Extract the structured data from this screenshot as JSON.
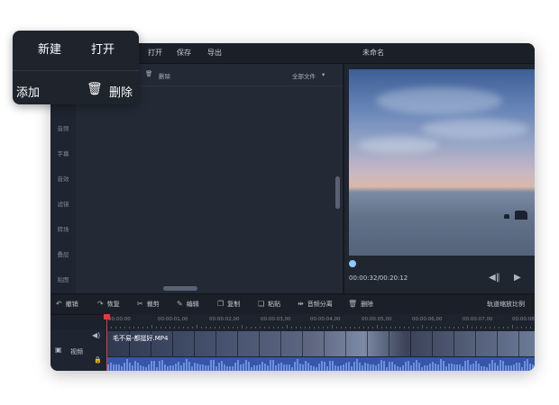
{
  "menu": {
    "open": "打开",
    "save": "保存",
    "export": "导出",
    "window_title": "未命名"
  },
  "popup": {
    "new": "新建",
    "open": "打开",
    "add": "添加",
    "delete": "删除"
  },
  "categories": [
    "音频",
    "字幕",
    "音效",
    "滤镜",
    "转场",
    "叠层",
    "贴图"
  ],
  "media_toolbar": {
    "delete": "删除",
    "filter": "全部文件",
    "filter_arrow": "▾"
  },
  "preview": {
    "timecode": "00:00:32/00:20:12",
    "progress_fraction": 0.0
  },
  "tools": [
    {
      "icon": "↶",
      "label": "撤销"
    },
    {
      "icon": "↷",
      "label": "恢复"
    },
    {
      "icon": "✂",
      "label": "裁剪"
    },
    {
      "icon": "✎",
      "label": "编辑"
    },
    {
      "icon": "❐",
      "label": "复制"
    },
    {
      "icon": "❏",
      "label": "粘贴"
    },
    {
      "icon": "⇹",
      "label": "音频分离"
    },
    {
      "icon": "🗑",
      "label": "删除"
    }
  ],
  "track_zoom": "轨道缩放比例",
  "ruler_labels": [
    "00:00:00",
    "00:00:01,00",
    "00:00:02,00",
    "00:00:03,00",
    "00:00:04,00",
    "00:00:05,00",
    "00:00:06,00",
    "00:00:07,00",
    "00:00:08"
  ],
  "track": {
    "video_label": "视频",
    "clip_name": "毛不易-都挺好.MP4"
  }
}
